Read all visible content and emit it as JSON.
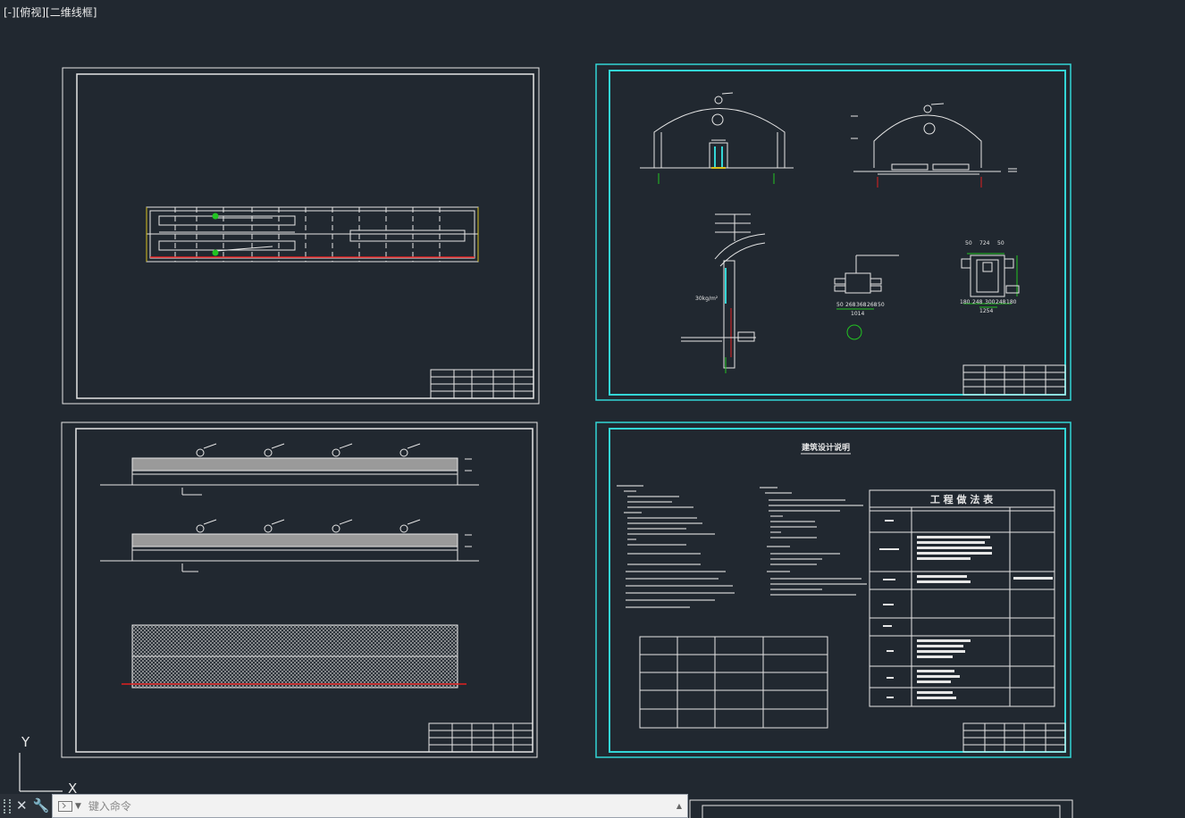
{
  "viewport": {
    "label": "[-][俯视][二维线框]"
  },
  "command_line": {
    "placeholder": "键入命令",
    "close_icon": "close-icon",
    "customize_icon": "wrench-icon",
    "history_icon": "triangle-up-icon"
  },
  "ucs": {
    "y_label": "Y",
    "x_label": "X"
  },
  "sheets": {
    "top_right": {
      "dimensions_door": [
        "50",
        "268",
        "368",
        "268",
        "50"
      ],
      "dimension_door_total": "1014",
      "dimensions_pit": [
        "50",
        "724",
        "50"
      ],
      "dimensions_pit_bottom": [
        "180",
        "248",
        "300",
        "248",
        "180"
      ],
      "dimension_pit_total": "1254",
      "note": "30kg/m²"
    },
    "bottom_right": {
      "title": "建筑设计说明",
      "table_title": "工 程 做 法 表"
    }
  },
  "colors": {
    "background": "#212830",
    "line": "#e6e6e6",
    "selected": "#33d6d6",
    "red": "#e02020",
    "green": "#22c422"
  }
}
